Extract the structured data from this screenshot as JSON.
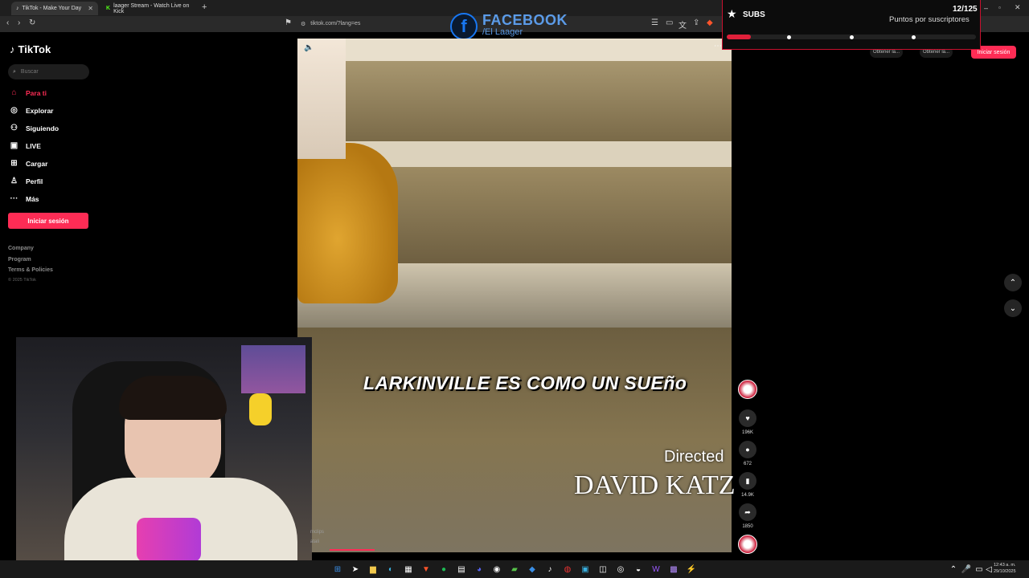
{
  "browser": {
    "tabs": [
      {
        "title": "TikTok - Make Your Day",
        "icon": "tiktok-icon"
      },
      {
        "title": "laager Stream - Watch Live on Kick",
        "icon": "kick-icon"
      }
    ],
    "url": "tiktok.com/?lang=es"
  },
  "overlay": {
    "fb_letter": "f",
    "fb_title": "FACEBOOK",
    "fb_handle": "/El Laager"
  },
  "sidebar": {
    "logo": "TikTok",
    "search_placeholder": "Buscar",
    "items": [
      {
        "label": "Para ti",
        "icon": "home-icon",
        "active": true
      },
      {
        "label": "Explorar",
        "icon": "compass-icon"
      },
      {
        "label": "Siguiendo",
        "icon": "user-following-icon"
      },
      {
        "label": "LIVE",
        "icon": "live-icon"
      },
      {
        "label": "Cargar",
        "icon": "upload-icon"
      },
      {
        "label": "Perfil",
        "icon": "person-icon"
      },
      {
        "label": "Más",
        "icon": "more-icon"
      }
    ],
    "login": "Iniciar sesión",
    "footer": [
      "Company",
      "Program",
      "Terms & Policies"
    ],
    "copyright": "© 2025 TikTok"
  },
  "video": {
    "caption": "LARKINVILLE ES COMO UN SUEño",
    "credit_line1": "Directed",
    "credit_line2": "DAVID KATZ",
    "progress": 0.1
  },
  "actions": [
    {
      "icon": "heart-icon",
      "count": "196K"
    },
    {
      "icon": "comment-icon",
      "count": "672"
    },
    {
      "icon": "bookmark-icon",
      "count": "14.9K"
    },
    {
      "icon": "share-icon",
      "count": "1850"
    }
  ],
  "topbar": {
    "btn1": "Obtener la...",
    "btn2": "Obtener la...",
    "login": "Iniciar sesión"
  },
  "subs_widget": {
    "title": "SUBS",
    "count": "12/125",
    "subtitle": "Puntos por suscriptores",
    "progress": 0.096,
    "colors": {
      "accent": "#e0203a"
    }
  },
  "webcam": {
    "watermark1": "mclips",
    "watermark2": "atali"
  },
  "taskbar": {
    "time": "12:43 a. m.",
    "date": "29/10/2025"
  },
  "colors": {
    "tiktok_red": "#fe2c55",
    "background": "#000000"
  }
}
